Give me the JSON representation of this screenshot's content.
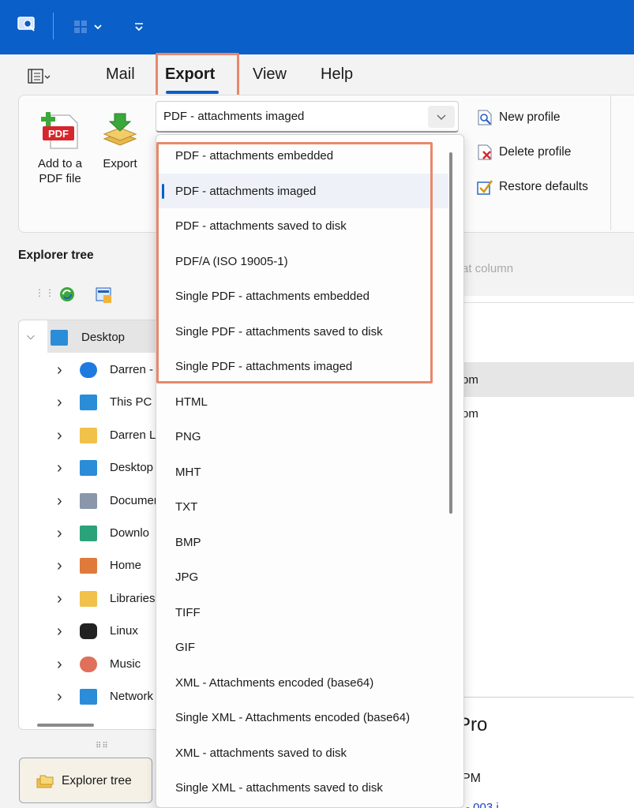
{
  "ribbon_tabs": [
    "Mail",
    "Export",
    "View",
    "Help"
  ],
  "ribbon_buttons": {
    "add_pdf": "Add to a\nPDF file",
    "export": "Export"
  },
  "combo": {
    "value": "PDF - attachments imaged"
  },
  "profile_actions": [
    "New profile",
    "Delete profile",
    "Restore defaults"
  ],
  "dropdown_items": [
    "PDF - attachments embedded",
    "PDF - attachments imaged",
    "PDF - attachments saved to disk",
    "PDF/A (ISO 19005-1)",
    "Single PDF - attachments embedded",
    "Single PDF - attachments saved to disk",
    "Single PDF - attachments imaged",
    "HTML",
    "PNG",
    "MHT",
    "TXT",
    "BMP",
    "JPG",
    "TIFF",
    "GIF",
    "XML - Attachments encoded (base64)",
    "Single XML - Attachments encoded (base64)",
    "XML - attachments saved to disk",
    "Single XML - attachments saved to disk"
  ],
  "explorer": {
    "title": "Explorer tree",
    "root": "Desktop",
    "items": [
      "Darren -",
      "This PC",
      "Darren L",
      "Desktop",
      "Documer",
      "Downlo",
      "Home",
      "Libraries",
      "Linux",
      "Music",
      "Network"
    ]
  },
  "right_panel": {
    "column_hint": "at column",
    "row1": "om",
    "row2": "om",
    "pro": "Pro",
    "pm": "PM",
    "link_partial": "- 003 i"
  },
  "bottom_nav": {
    "label": "Explorer tree"
  },
  "colors": {
    "accent": "#0a5fc9",
    "highlight": "#e8886a"
  }
}
